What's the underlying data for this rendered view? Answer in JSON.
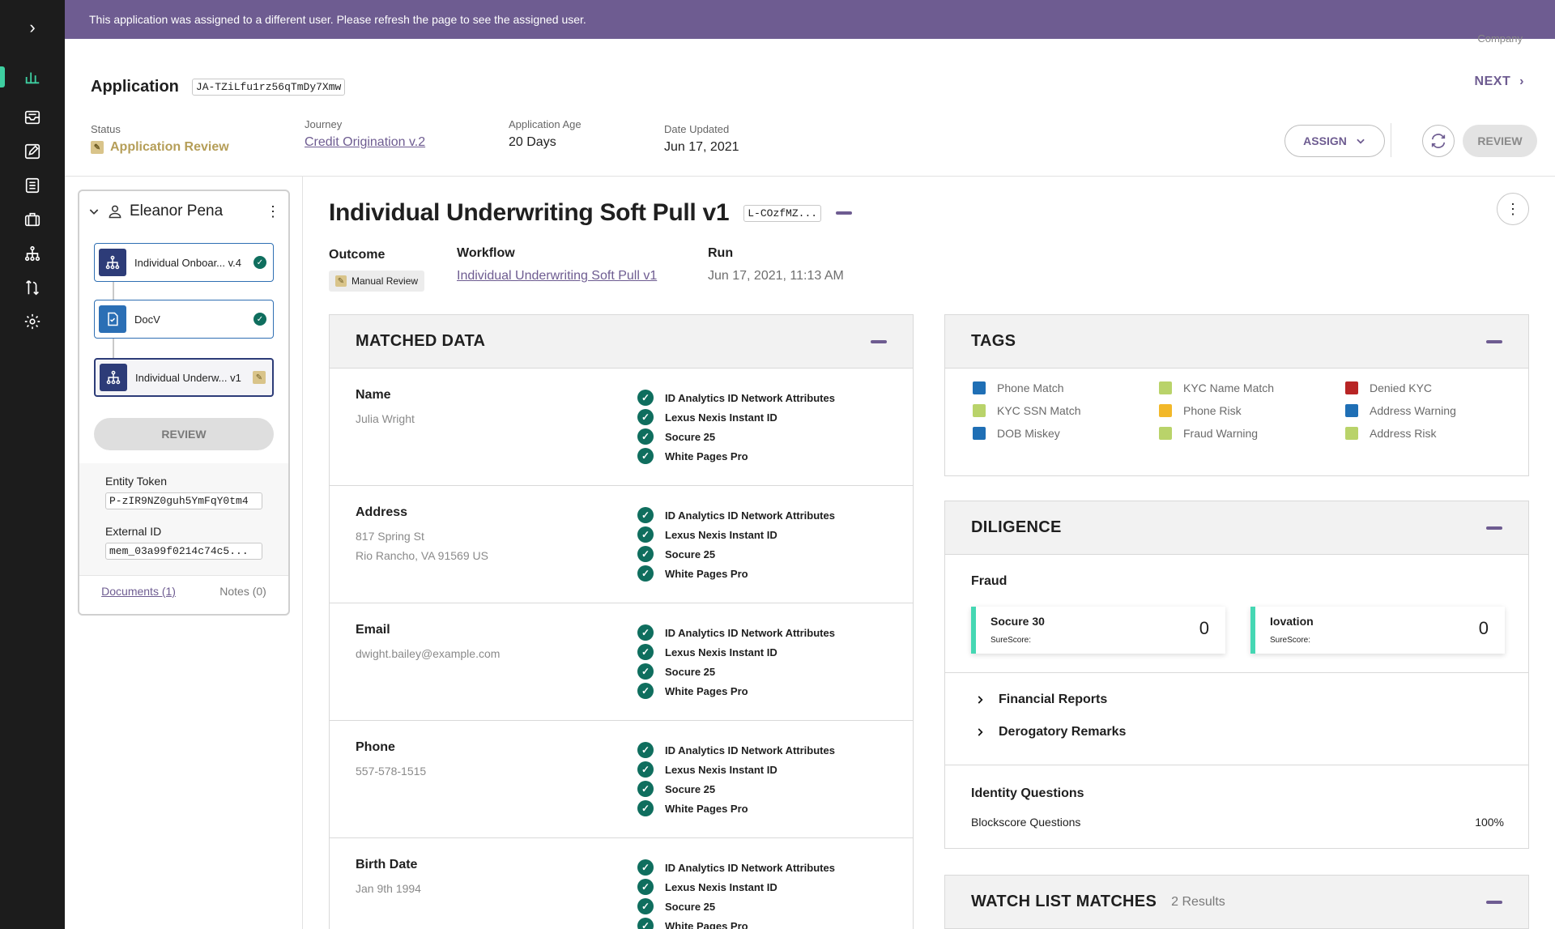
{
  "banner": {
    "message": "This application was assigned to a different user. Please refresh the page to see the assigned user."
  },
  "header": {
    "partial_text": "Company",
    "application_label": "Application",
    "application_id": "JA-TZiLfu1rz56qTmDy7Xmw",
    "next_label": "NEXT",
    "status_label": "Status",
    "status_value": "Application Review",
    "journey_label": "Journey",
    "journey_value": "Credit Origination v.2",
    "age_label": "Application Age",
    "age_value": "20 Days",
    "updated_label": "Date Updated",
    "updated_value": "Jun 17, 2021",
    "assign_label": "ASSIGN",
    "review_label": "REVIEW"
  },
  "sidebar": {
    "entity_name": "Eleanor Pena",
    "workflows": [
      {
        "label": "Individual Onboar... v.4",
        "state": "complete"
      },
      {
        "label": "DocV",
        "state": "complete"
      },
      {
        "label": "Individual Underw... v1",
        "state": "review"
      }
    ],
    "review_label": "REVIEW",
    "entity_token_label": "Entity Token",
    "entity_token_value": "P-zIR9NZ0guh5YmFqY0tm4",
    "external_id_label": "External ID",
    "external_id_value": "mem_03a99f0214c74c5...",
    "documents_label": "Documents (1)",
    "notes_label": "Notes (0)"
  },
  "main": {
    "title": "Individual Underwriting Soft Pull v1",
    "title_id": "L-COzfMZ...",
    "outcome_label": "Outcome",
    "outcome_value": "Manual Review",
    "workflow_label": "Workflow",
    "workflow_value": "Individual Underwriting Soft Pull v1",
    "run_label": "Run",
    "run_value": "Jun 17, 2021, 11:13 AM"
  },
  "matched_data": {
    "title": "MATCHED DATA",
    "rows": [
      {
        "field": "Name",
        "lines": [
          "Julia Wright"
        ],
        "sources": [
          "ID Analytics ID Network Attributes",
          "Lexus Nexis Instant ID",
          "Socure 25",
          "White Pages Pro"
        ]
      },
      {
        "field": "Address",
        "lines": [
          "817 Spring St",
          "Rio Rancho, VA 91569 US"
        ],
        "sources": [
          "ID Analytics ID Network Attributes",
          "Lexus Nexis Instant ID",
          "Socure 25",
          "White Pages Pro"
        ]
      },
      {
        "field": "Email",
        "lines": [
          "dwight.bailey@example.com"
        ],
        "sources": [
          "ID Analytics ID Network Attributes",
          "Lexus Nexis Instant ID",
          "Socure 25",
          "White Pages Pro"
        ]
      },
      {
        "field": "Phone",
        "lines": [
          "557-578-1515"
        ],
        "sources": [
          "ID Analytics ID Network Attributes",
          "Lexus Nexis Instant ID",
          "Socure 25",
          "White Pages Pro"
        ]
      },
      {
        "field": "Birth Date",
        "lines": [
          "Jan 9th 1994"
        ],
        "sources": [
          "ID Analytics ID Network Attributes",
          "Lexus Nexis Instant ID",
          "Socure 25",
          "White Pages Pro"
        ]
      }
    ]
  },
  "tags": {
    "title": "TAGS",
    "items": [
      {
        "label": "Phone Match",
        "color": "#1f6fb5"
      },
      {
        "label": "KYC SSN Match",
        "color": "#b9d36a"
      },
      {
        "label": "DOB Miskey",
        "color": "#1f6fb5"
      },
      {
        "label": "KYC Name Match",
        "color": "#b9d36a"
      },
      {
        "label": "Phone Risk",
        "color": "#f2b829"
      },
      {
        "label": "Fraud Warning",
        "color": "#b9d36a"
      },
      {
        "label": "Denied KYC",
        "color": "#b82525"
      },
      {
        "label": "Address Warning",
        "color": "#1f6fb5"
      },
      {
        "label": "Address Risk",
        "color": "#b9d36a"
      }
    ]
  },
  "diligence": {
    "title": "DILIGENCE",
    "fraud_label": "Fraud",
    "scores": [
      {
        "name": "Socure 30",
        "sub": "SureScore:",
        "value": "0"
      },
      {
        "name": "Iovation",
        "sub": "SureScore:",
        "value": "0"
      }
    ],
    "financial_reports_label": "Financial Reports",
    "derogatory_label": "Derogatory Remarks",
    "identity_questions_label": "Identity Questions",
    "blockscore_label": "Blockscore Questions",
    "blockscore_value": "100%"
  },
  "watchlist": {
    "title": "WATCH LIST MATCHES",
    "count": "2 Results"
  },
  "colors": {
    "brand": "#6e5c91",
    "rail": "#1c1c1c",
    "accent": "#3ecfa1",
    "check": "#0f6e5e"
  }
}
